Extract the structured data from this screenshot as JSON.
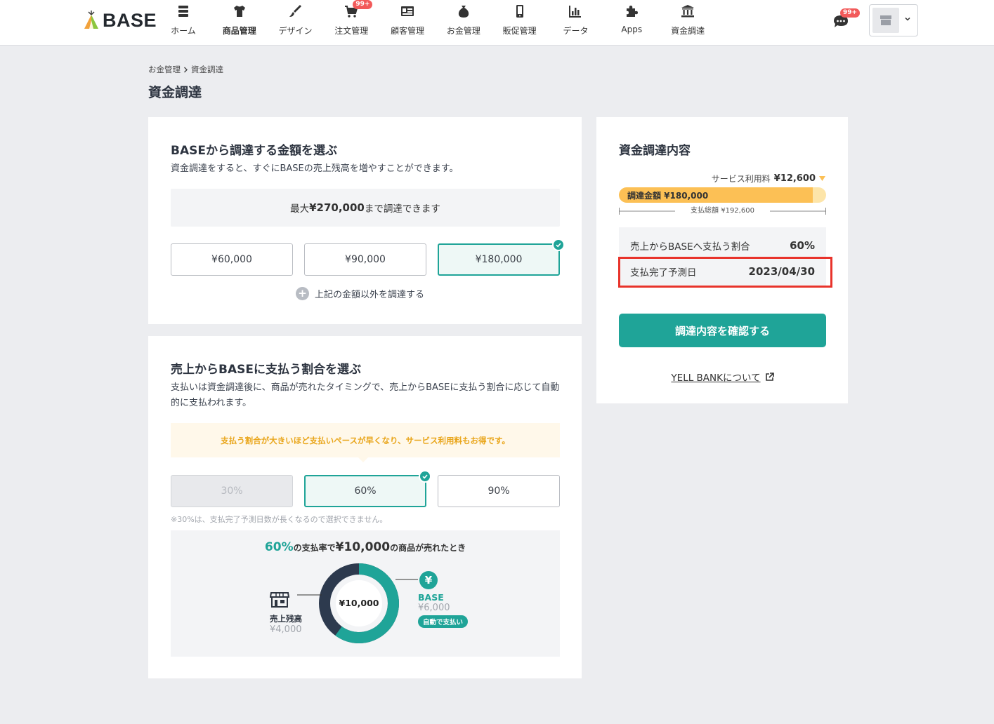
{
  "brand": {
    "name": "BASE"
  },
  "nav": [
    {
      "label": "ホーム",
      "icon": "home-icon"
    },
    {
      "label": "商品管理",
      "icon": "tshirt-icon",
      "active": true
    },
    {
      "label": "デザイン",
      "icon": "brush-icon"
    },
    {
      "label": "注文管理",
      "icon": "cart-icon",
      "badge": "99+"
    },
    {
      "label": "顧客管理",
      "icon": "address-card-icon"
    },
    {
      "label": "お金管理",
      "icon": "wallet-icon"
    },
    {
      "label": "販促管理",
      "icon": "smartphone-icon"
    },
    {
      "label": "データ",
      "icon": "bar-chart-icon"
    },
    {
      "label": "Apps",
      "icon": "puzzle-icon"
    },
    {
      "label": "資金調達",
      "icon": "bank-icon"
    }
  ],
  "header": {
    "chat_badge": "99+"
  },
  "breadcrumb": {
    "parent": "お金管理",
    "current": "資金調達"
  },
  "page": {
    "title": "資金調達"
  },
  "amount_section": {
    "title": "BASEから調達する金額を選ぶ",
    "description": "資金調達をすると、すぐにBASEの売上残高を増やすことができます。",
    "max_prefix": "最大",
    "max_amount": "¥270,000",
    "max_suffix": "まで調達できます",
    "options": [
      "¥60,000",
      "¥90,000",
      "¥180,000"
    ],
    "selected_index": 2,
    "other_link": "上記の金額以外を調達する"
  },
  "ratio_section": {
    "title": "売上からBASEに支払う割合を選ぶ",
    "description": "支払いは資金調達後に、商品が売れたタイミングで、売上からBASEに支払う割合に応じて自動的に支払われます。",
    "hint": "支払う割合が大きいほど支払いペースが早くなり、サービス利用料もお得です。",
    "options": [
      "30%",
      "60%",
      "90%"
    ],
    "disabled_index": 0,
    "selected_index": 1,
    "note": "※30%は、支払完了予測日数が長くなるので選択できません。",
    "example": {
      "rate": "60%",
      "text1": "の支払率で",
      "price": "¥10,000",
      "text2": "の商品が売れたとき",
      "center": "¥10,000",
      "left_label": "売上残高",
      "left_value": "¥4,000",
      "right_label": "BASE",
      "right_value": "¥6,000",
      "right_badge": "自動で支払い",
      "base_share": 0.6
    }
  },
  "summary": {
    "title": "資金調達内容",
    "fee_label": "サービス利用料",
    "fee_value": "¥12,600",
    "bar_label": "調達金額 ¥180,000",
    "bar_fraction": 0.9346,
    "total_label": "支払総額 ¥192,600",
    "rows": [
      {
        "label": "売上からBASEへ支払う割合",
        "value": "60%"
      },
      {
        "label": "支払完了予測日",
        "value": "2023/04/30"
      }
    ],
    "confirm_button": "調達内容を確認する",
    "yell_link": "YELL BANKについて"
  },
  "colors": {
    "accent": "#1fa498",
    "navy": "#2d3a4e",
    "bar": "#fcc055",
    "highlight": "#e8332b"
  }
}
